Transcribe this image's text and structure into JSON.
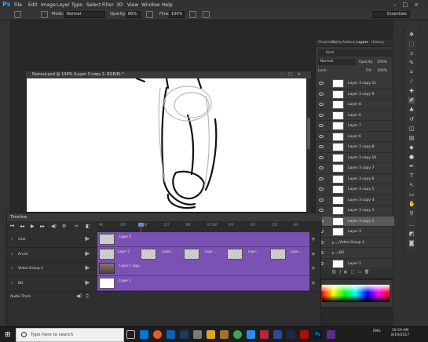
{
  "menu": [
    "File",
    "Edit",
    "Image",
    "Layer",
    "Type",
    "Select",
    "Filter",
    "3D",
    "View",
    "Window",
    "Help"
  ],
  "options": {
    "mode_label": "Mode:",
    "mode_value": "Normal",
    "opacity_label": "Opacity:",
    "opacity_value": "80%",
    "flow_label": "Flow:",
    "flow_value": "100%",
    "workspace": "Essentials"
  },
  "document": {
    "title": "Parcour.psd @ 100% (Layer 3 copy 2, RGB/8) *"
  },
  "panel_tabs": [
    "Channels",
    "Paths",
    "Actions",
    "Layers",
    "History"
  ],
  "layers_panel": {
    "kind_label": "Kind",
    "blend": "Normal",
    "opacity_label": "Opacity:",
    "opacity_value": "100%",
    "lock_label": "Lock:",
    "fill_label": "Fill:",
    "fill_value": "100%"
  },
  "layers": [
    {
      "name": "Layer 3 copy 11",
      "selected": false
    },
    {
      "name": "Layer 3 copy 9",
      "selected": false
    },
    {
      "name": "Layer 8",
      "selected": false
    },
    {
      "name": "Layer 6",
      "selected": false
    },
    {
      "name": "Layer 7",
      "selected": false
    },
    {
      "name": "Layer 6",
      "selected": false
    },
    {
      "name": "Layer 3 copy 8",
      "selected": false
    },
    {
      "name": "Layer 3 copy 10",
      "selected": false
    },
    {
      "name": "Layer 3 copy 7",
      "selected": false
    },
    {
      "name": "Layer 3 copy 6",
      "selected": false
    },
    {
      "name": "Layer 3 copy 5",
      "selected": false
    },
    {
      "name": "Layer 3 copy 4",
      "selected": false
    },
    {
      "name": "Layer 3 copy 3",
      "selected": false
    },
    {
      "name": "Layer 3 copy 2",
      "selected": true
    },
    {
      "name": "Layer 3",
      "selected": false
    },
    {
      "name": "Video Group 1",
      "selected": false,
      "group": true
    },
    {
      "name": "BG",
      "selected": false,
      "group": true
    },
    {
      "name": "Layer 1",
      "selected": false
    }
  ],
  "timeline": {
    "title": "Timeline",
    "ruler": [
      "00",
      "05f",
      "10f",
      "15f",
      "20f",
      "01:00f",
      "05f",
      "10f",
      "15f",
      "20f"
    ],
    "tracks": [
      {
        "name": "char",
        "clips": [
          {
            "label": "Layer 4"
          }
        ]
      },
      {
        "name": "Arcon",
        "clips": [
          {
            "label": "Layer 2"
          },
          {
            "label": "Layer..."
          },
          {
            "label": "Laye..."
          },
          {
            "label": "Laye..."
          },
          {
            "label": "Laye..."
          }
        ]
      },
      {
        "name": "Video Group 1",
        "clips": [
          {
            "label": "Layer 1 copy"
          }
        ]
      },
      {
        "name": "BG",
        "clips": [
          {
            "label": "Layer 1"
          }
        ]
      }
    ],
    "audio_label": "Audio Track"
  },
  "taskbar": {
    "search_placeholder": "Type here to search",
    "lang": "ENG",
    "time": "10:59 AM",
    "date": "8/19/2017"
  }
}
